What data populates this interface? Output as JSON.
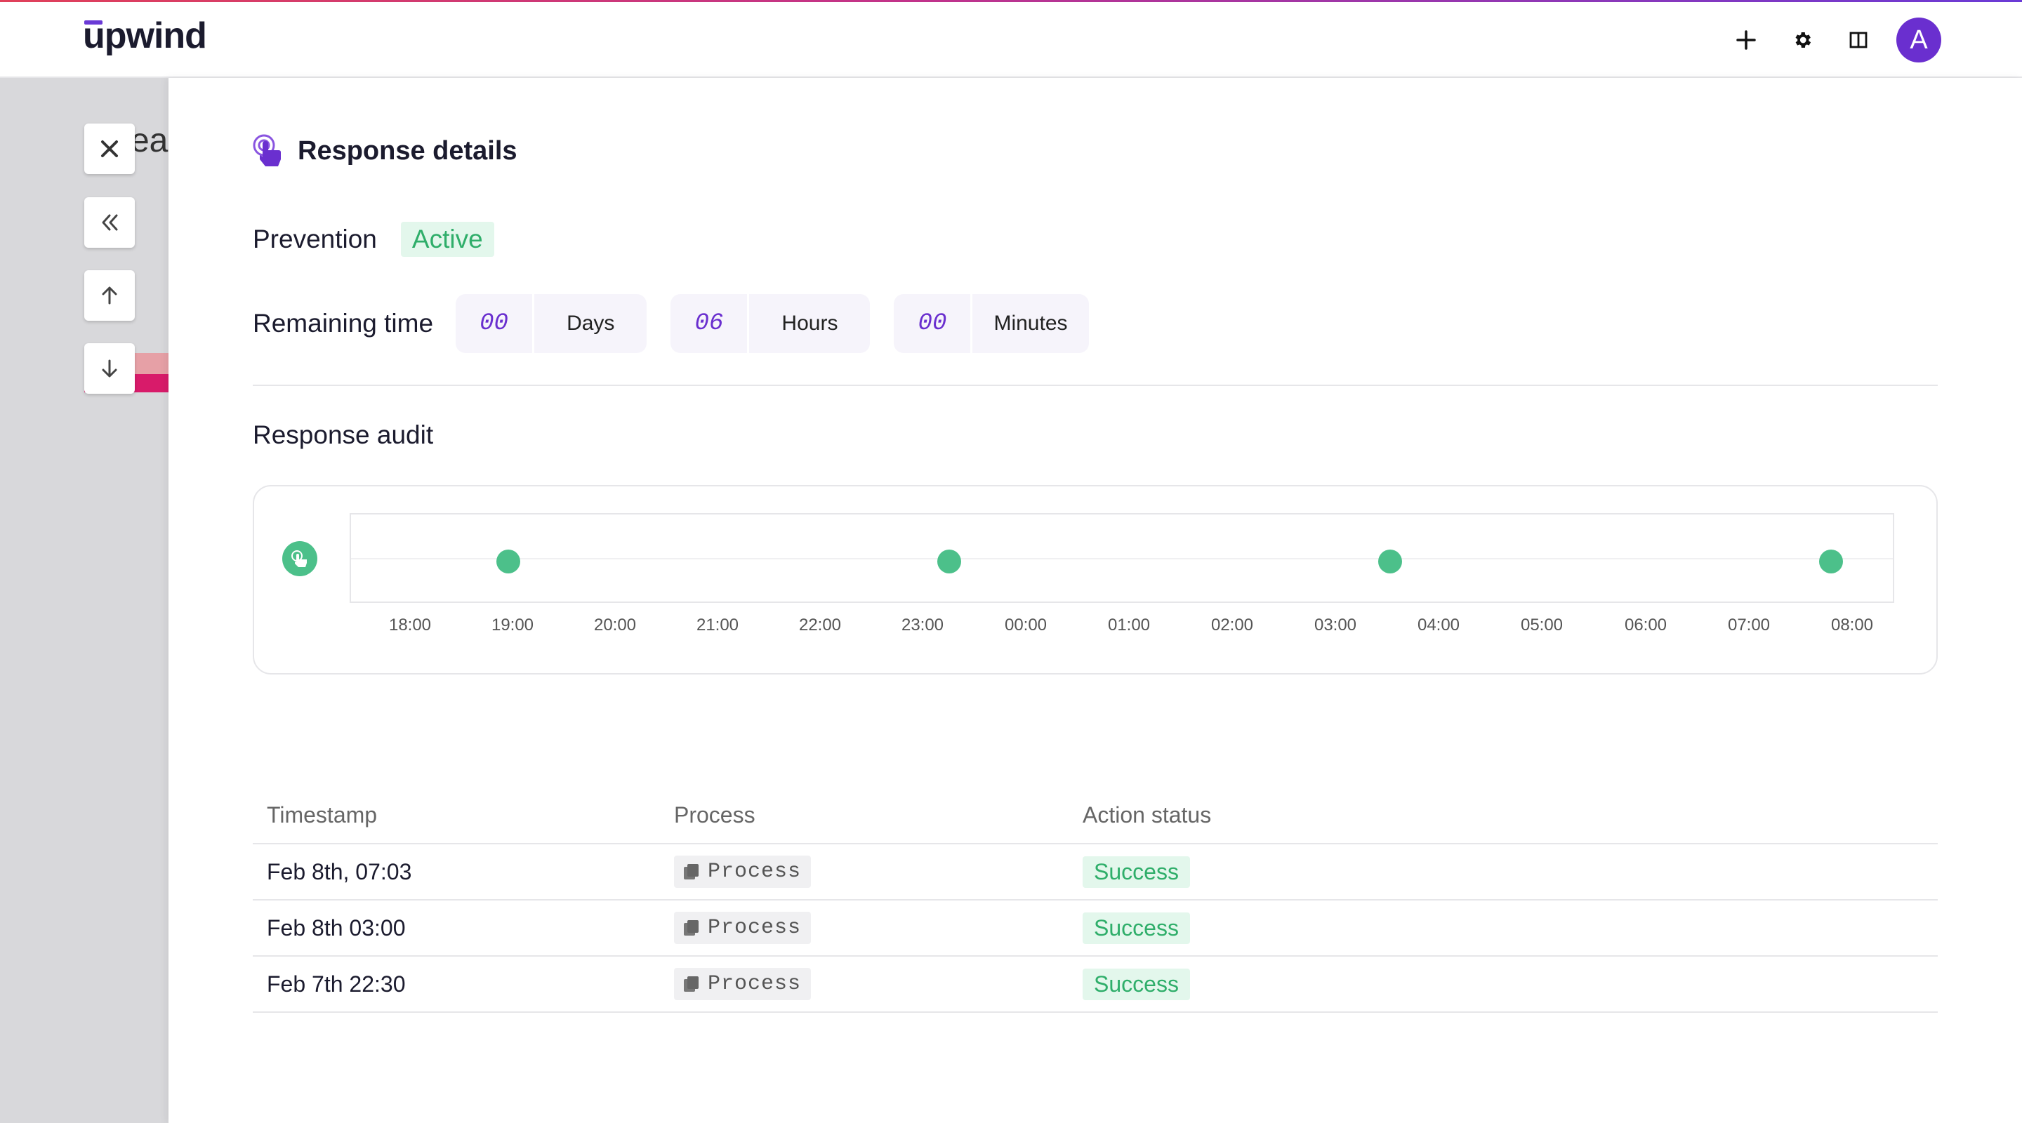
{
  "app": {
    "logo_text": "upwind",
    "avatar_initial": "A"
  },
  "topbar": {
    "icons": [
      "plus-icon",
      "gear-icon",
      "panel-icon"
    ]
  },
  "background_page": {
    "title_fragment": "rea"
  },
  "side_controls": [
    "close-icon",
    "double-chevron-left-icon",
    "arrow-up-icon",
    "arrow-down-icon"
  ],
  "panel": {
    "title": "Response details",
    "prevention": {
      "label": "Prevention",
      "status": "Active"
    },
    "remaining": {
      "label": "Remaining time",
      "days": {
        "value": "00",
        "unit": "Days"
      },
      "hours": {
        "value": "06",
        "unit": "Hours"
      },
      "minutes": {
        "value": "00",
        "unit": "Minutes"
      }
    },
    "audit": {
      "title": "Response audit",
      "ticks": [
        "18:00",
        "19:00",
        "20:00",
        "21:00",
        "22:00",
        "23:00",
        "00:00",
        "01:00",
        "02:00",
        "03:00",
        "04:00",
        "05:00",
        "06:00",
        "07:00",
        "08:00"
      ]
    },
    "table": {
      "headers": [
        "Timestamp",
        "Process",
        "Action status"
      ],
      "rows": [
        {
          "timestamp": "Feb 8th, 07:03",
          "process": "Process",
          "status": "Success"
        },
        {
          "timestamp": "Feb 8th 03:00",
          "process": "Process",
          "status": "Success"
        },
        {
          "timestamp": "Feb 7th 22:30",
          "process": "Process",
          "status": "Success"
        }
      ]
    }
  },
  "colors": {
    "accent": "#6a2fcf",
    "success": "#2fae6a",
    "success_bg": "#e3f7ec",
    "dot": "#4cc08a"
  }
}
